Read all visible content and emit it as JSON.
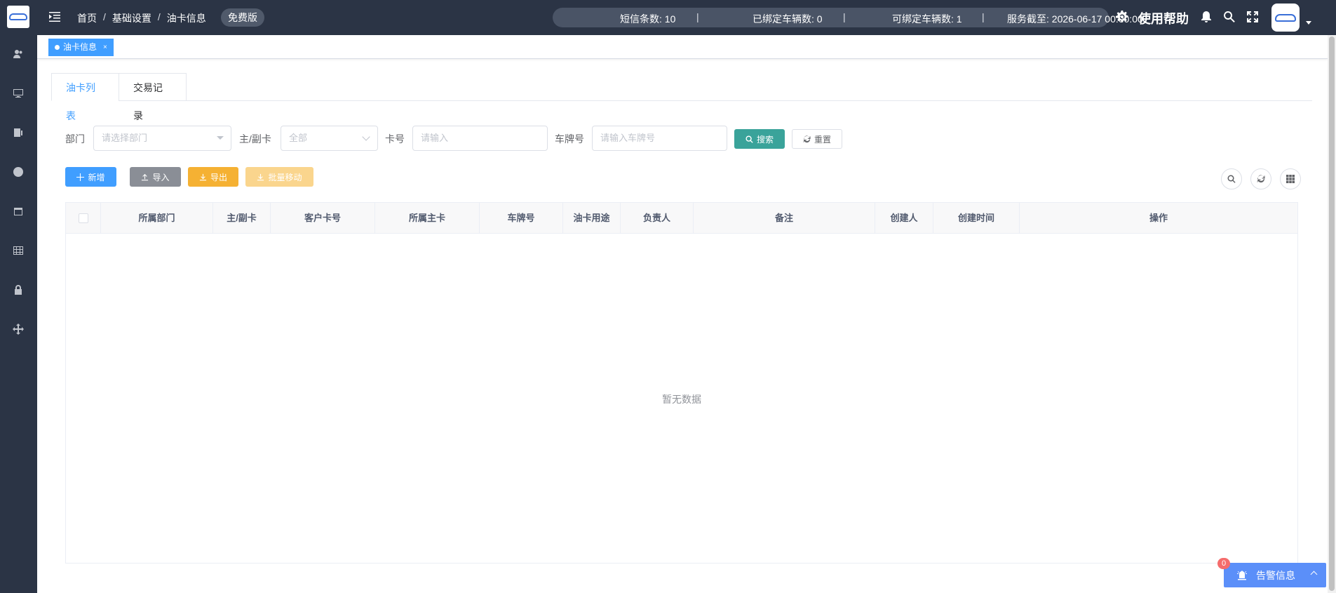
{
  "header": {
    "breadcrumb": [
      "首页",
      "基础设置",
      "油卡信息"
    ],
    "breadcrumb_sep": "/",
    "edition": "免费版",
    "stats": {
      "sms": "短信条数: 10",
      "bound": "已绑定车辆数: 0",
      "bindable": "可绑定车辆数: 1",
      "service": "服务截至: 2026-06-17 00:00:00"
    },
    "help": "使用帮助"
  },
  "tagsbar": {
    "active_tag": "油卡信息",
    "close": "×"
  },
  "tabs": [
    {
      "label": "油卡列表",
      "active": true
    },
    {
      "label": "交易记录",
      "active": false
    }
  ],
  "filters": {
    "dept_label": "部门",
    "dept_placeholder": "请选择部门",
    "cardtype_label": "主/副卡",
    "cardtype_value": "全部",
    "cardno_label": "卡号",
    "cardno_placeholder": "请输入",
    "plate_label": "车牌号",
    "plate_placeholder": "请输入车牌号",
    "search": "搜索",
    "reset": "重置"
  },
  "toolbar": {
    "add": "新增",
    "import": "导入",
    "export": "导出",
    "batch_move": "批量移动"
  },
  "table": {
    "columns": [
      "所属部门",
      "主/副卡",
      "客户卡号",
      "所属主卡",
      "车牌号",
      "油卡用途",
      "负责人",
      "备注",
      "创建人",
      "创建时间",
      "操作"
    ],
    "rows": [],
    "empty_text": "暂无数据"
  },
  "alarm": {
    "label": "告警信息",
    "count": "0"
  },
  "colors": {
    "sidebar": "#2b3445",
    "primary": "#409eff",
    "search": "#3aa39a",
    "export": "#f5b133",
    "alarm": "#5b8ff9"
  }
}
